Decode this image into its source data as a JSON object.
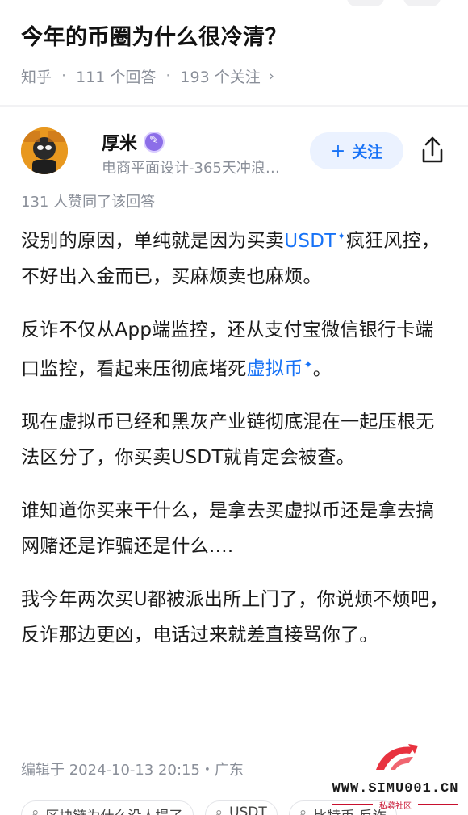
{
  "question": {
    "title": "今年的币圈为什么很冷清？",
    "source": "知乎",
    "answers": "111 个回答",
    "followers": "193 个关注"
  },
  "author": {
    "name": "厚米",
    "description": "电商平面设计-365天冲浪…",
    "follow_label": "关注"
  },
  "likes_text": "131 人赞同了该回答",
  "answer": {
    "p1_a": "没别的原因，单纯就是因为买卖",
    "p1_link": "USDT",
    "p1_b": "疯狂风控，不好出入金而已，买麻烦卖也麻烦。",
    "p2_a": "反诈不仅从App端监控，还从支付宝微信银行卡端口监控，看起来压彻底堵死",
    "p2_link": "虚拟币",
    "p2_b": "。",
    "p3": "现在虚拟币已经和黑灰产业链彻底混在一起压根无法区分了，你买卖USDT就肯定会被查。",
    "p4": "谁知道你买来干什么，是拿去买虚拟币还是拿去搞网赌还是诈骗还是什么....",
    "p5": "我今年两次买U都被派出所上门了，你说烦不烦吧，反诈那边更凶，电话过来就差直接骂你了。"
  },
  "edited": "编辑于 2024-10-13 20:15・广东",
  "watermark": {
    "url": "WWW.SIMU001.CN",
    "sub": "私募社区"
  },
  "tags": [
    "区块链为什么没人提了",
    "USDT",
    "比特币 反诈"
  ],
  "colors": {
    "accent": "#1772f6",
    "muted": "#8a8f99"
  }
}
